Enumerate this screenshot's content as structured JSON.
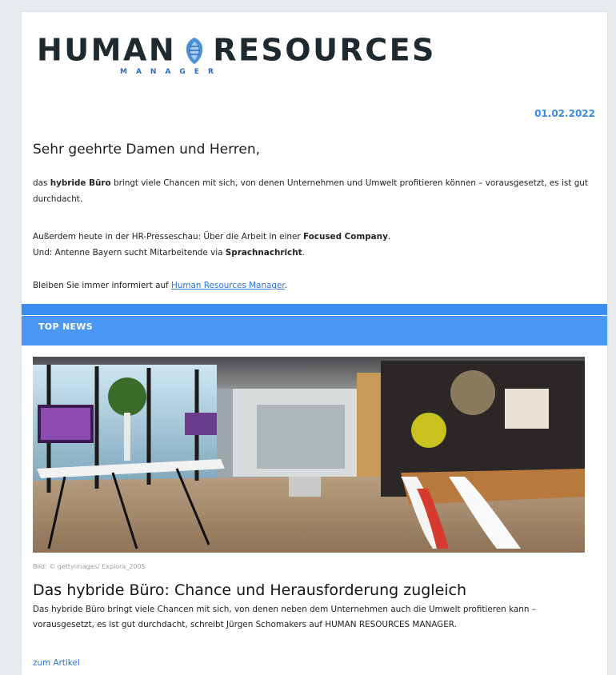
{
  "header": {
    "logo_left": "HUMAN",
    "logo_right": "RESOURCES",
    "logo_sub": "MANAGER",
    "date": "01.02.2022"
  },
  "intro": {
    "greeting": "Sehr geehrte Damen und Herren,",
    "p1_a": "das ",
    "p1_b": "hybride Büro",
    "p1_c": " bringt viele Chancen mit sich, von denen Unternehmen und Umwelt profitieren können – vorausgesetzt, es ist gut durchdacht.",
    "p2_a": "Außerdem heute in der HR-Presseschau: Über die Arbeit in einer ",
    "p2_b": "Focused Company",
    "p2_c": ".",
    "p2_d": "Und: Antenne Bayern sucht Mitarbeitende via ",
    "p2_e": "Sprachnachricht",
    "p2_f": ".",
    "p3_a": "Bleiben Sie immer informiert auf ",
    "p3_link": "Human Resources Manager",
    "p3_c": "."
  },
  "section": {
    "label": "TOP NEWS"
  },
  "article": {
    "caption": "Bild: © gettyimages/ Explora_2005",
    "headline": "Das hybride Büro: Chance und Herausforderung zugleich",
    "summary": "Das hybride Büro bringt viele Chancen mit sich, von denen neben dem Unternehmen auch die Umwelt profitieren kann – vorausgesetzt, es ist gut durchdacht, schreibt Jürgen Schomakers auf HUMAN RESOURCES MANAGER.",
    "read_more": "zum Artikel"
  },
  "colors": {
    "accent": "#3b8ef0",
    "link": "#2a73d9",
    "date": "#3a8ae6"
  }
}
